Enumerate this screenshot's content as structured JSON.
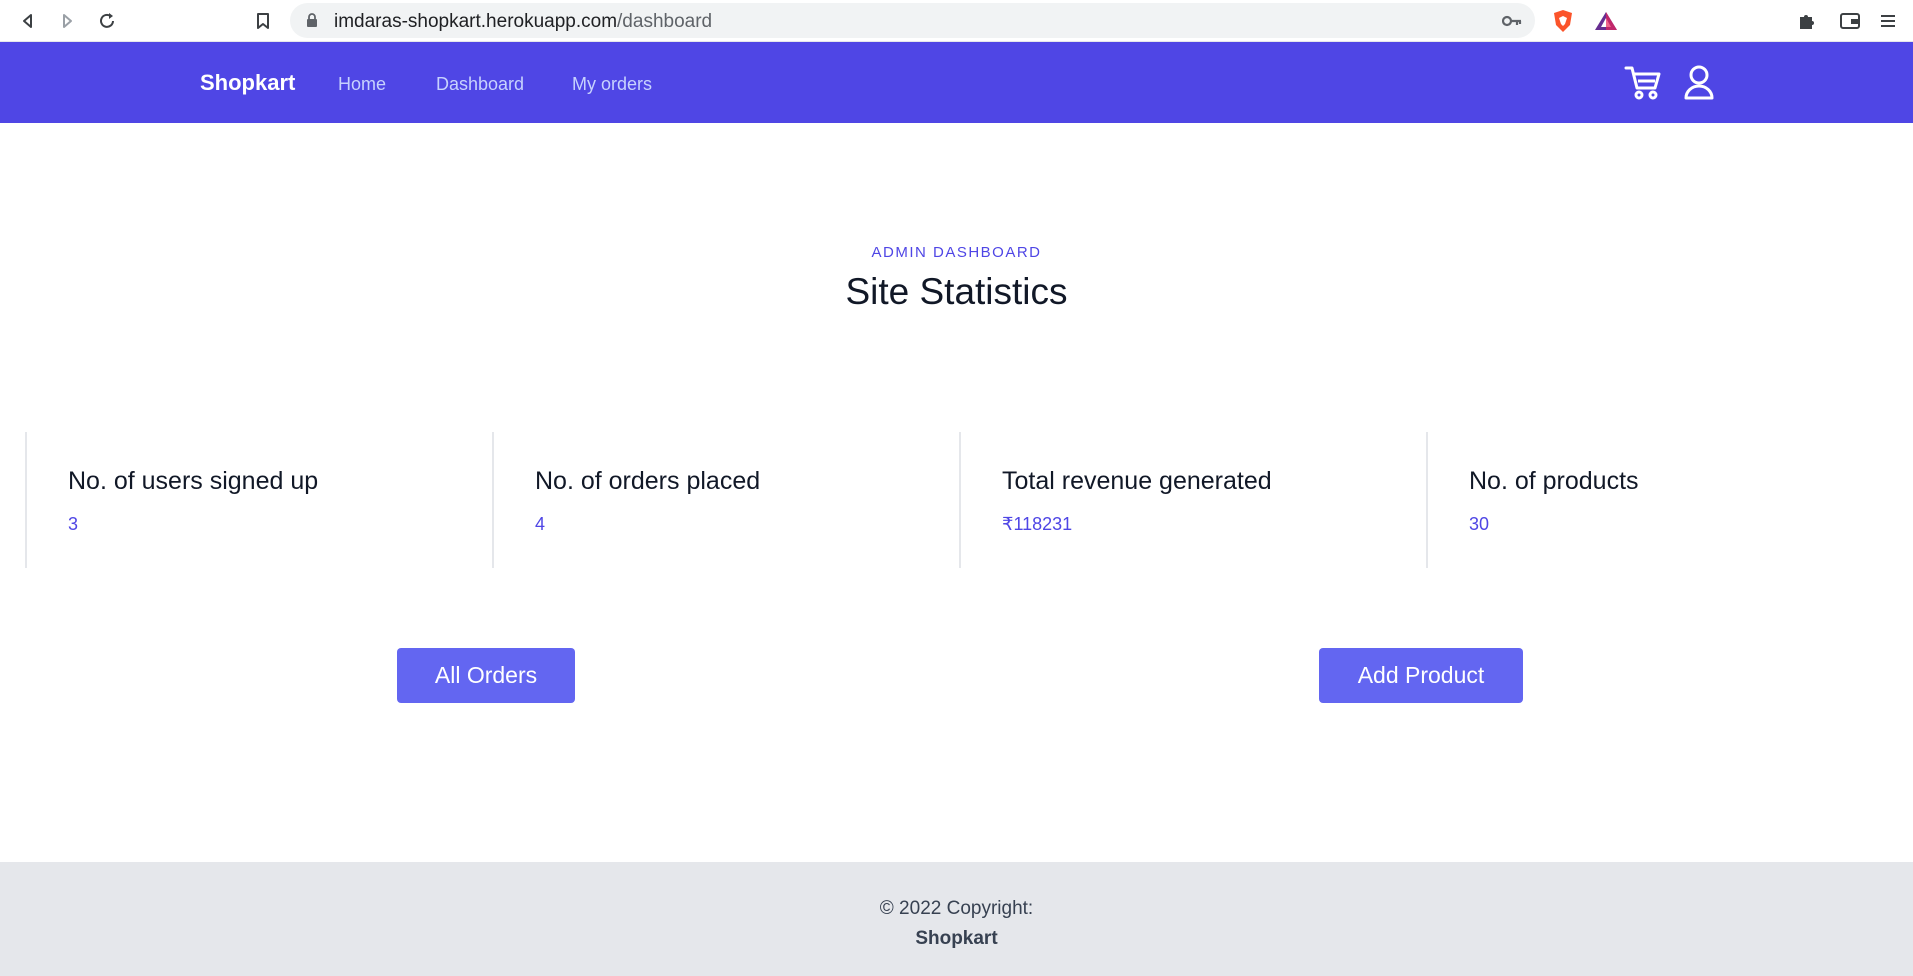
{
  "browser": {
    "url_host": "imdaras-shopkart.herokuapp.com",
    "url_path": "/dashboard"
  },
  "navbar": {
    "brand": "Shopkart",
    "links": [
      "Home",
      "Dashboard",
      "My orders"
    ],
    "icons": [
      "cart-icon",
      "user-icon"
    ],
    "background": "#4f46e5"
  },
  "header": {
    "eyebrow": "ADMIN DASHBOARD",
    "title": "Site Statistics"
  },
  "stats": [
    {
      "label": "No. of users signed up",
      "value": "3"
    },
    {
      "label": "No. of orders placed",
      "value": "4"
    },
    {
      "label": "Total revenue generated",
      "value": "₹118231"
    },
    {
      "label": "No. of products",
      "value": "30"
    }
  ],
  "actions": {
    "all_orders": "All Orders",
    "add_product": "Add Product"
  },
  "footer": {
    "copyright": "© 2022 Copyright:",
    "owner": "Shopkart"
  },
  "colors": {
    "accent": "#4f46e5",
    "button": "#6366f1",
    "footer_bg": "#e5e7eb"
  }
}
